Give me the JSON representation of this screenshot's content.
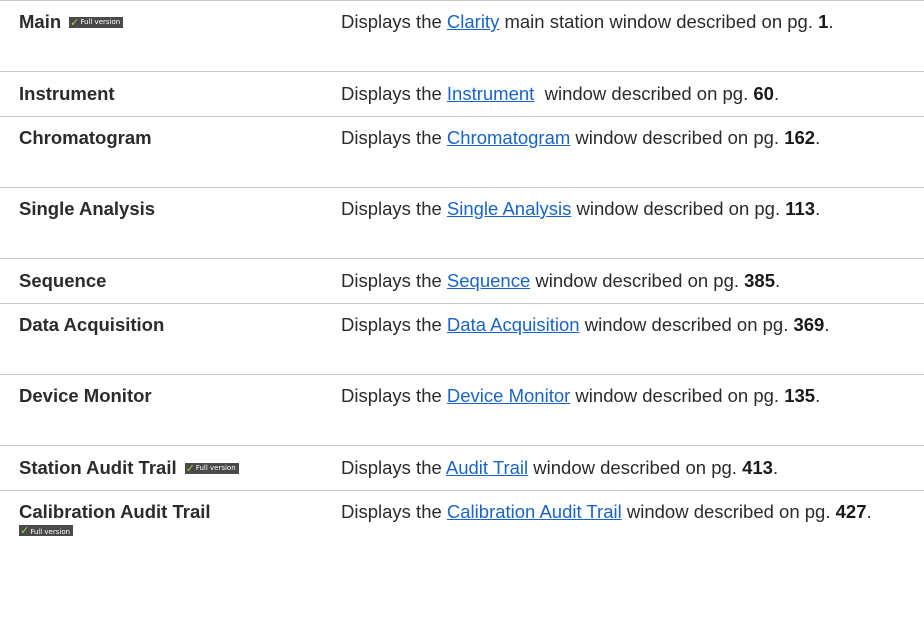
{
  "badge": {
    "check": "✓",
    "label": "Full version"
  },
  "colors": {
    "link": "#1a64c8",
    "text": "#2b2b2b",
    "divider": "#c8c8c8",
    "badge_bg": "#4a4a4a",
    "badge_check": "#9bd64a"
  },
  "rows": [
    {
      "name": "Main",
      "full_version": true,
      "prefix": "Displays the ",
      "link": "Clarity",
      "suffix": " main station window described on pg. ",
      "page": "1",
      "end": "."
    },
    {
      "name": "Instrument",
      "full_version": false,
      "prefix": "Displays the ",
      "link": "Instrument",
      "suffix": "  window described on pg. ",
      "page": "60",
      "end": "."
    },
    {
      "name": "Chromatogram",
      "full_version": false,
      "prefix": "Displays the ",
      "link": "Chromatogram",
      "suffix": " window described on pg. ",
      "page": "162",
      "end": "."
    },
    {
      "name": "Single Analysis",
      "full_version": false,
      "prefix": "Displays the ",
      "link": "Single Analysis",
      "suffix": " window described on pg. ",
      "page": "113",
      "end": "."
    },
    {
      "name": "Sequence",
      "full_version": false,
      "prefix": "Displays the ",
      "link": "Sequence",
      "suffix": " window described on pg. ",
      "page": "385",
      "end": "."
    },
    {
      "name": "Data Acquisition",
      "full_version": false,
      "prefix": "Displays the ",
      "link": "Data Acquisition",
      "suffix": " window described on pg. ",
      "page": "369",
      "end": "."
    },
    {
      "name": "Device Monitor",
      "full_version": false,
      "prefix": "Displays the ",
      "link": "Device Monitor",
      "suffix": " window described on pg. ",
      "page": "135",
      "end": "."
    },
    {
      "name": "Station Audit Trail",
      "full_version": true,
      "prefix": "Displays the ",
      "link": "Audit Trail",
      "suffix": " window described on pg. ",
      "page": "413",
      "end": "."
    },
    {
      "name": "Calibration Audit Trail",
      "full_version": true,
      "prefix": "Displays the ",
      "link": "Calibration Audit Trail",
      "suffix": " window described on pg. ",
      "page": "427",
      "end": "."
    }
  ]
}
